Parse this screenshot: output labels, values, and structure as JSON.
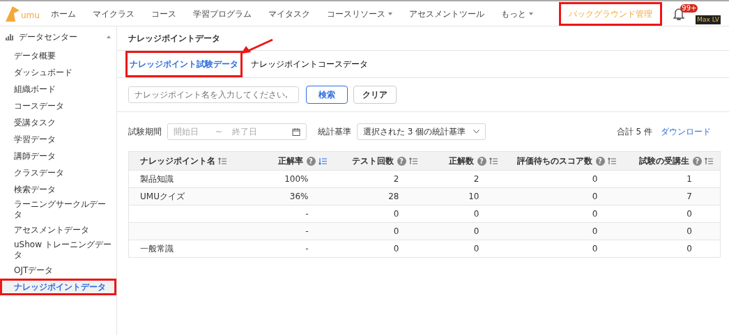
{
  "nav": {
    "logo": "umu",
    "items": [
      {
        "label": "ホーム",
        "dropdown": false
      },
      {
        "label": "マイクラス",
        "dropdown": false
      },
      {
        "label": "コース",
        "dropdown": false
      },
      {
        "label": "学習プログラム",
        "dropdown": false
      },
      {
        "label": "マイタスク",
        "dropdown": false
      },
      {
        "label": "コースリソース",
        "dropdown": true
      },
      {
        "label": "アセスメントツール",
        "dropdown": false
      },
      {
        "label": "もっと",
        "dropdown": true
      }
    ],
    "admin_link": {
      "label": "バックグラウンド管理",
      "highlighted": true
    },
    "notification_badge": "99+",
    "level_badge": "Max LV"
  },
  "sidebar": {
    "section": {
      "label": "データセンター",
      "expanded": true
    },
    "items": [
      {
        "label": "データ概要",
        "selected": false,
        "highlighted": false
      },
      {
        "label": "ダッシュボード",
        "selected": false,
        "highlighted": false
      },
      {
        "label": "組織ボード",
        "selected": false,
        "highlighted": false
      },
      {
        "label": "コースデータ",
        "selected": false,
        "highlighted": false
      },
      {
        "label": "受講タスク",
        "selected": false,
        "highlighted": false
      },
      {
        "label": "学習データ",
        "selected": false,
        "highlighted": false
      },
      {
        "label": "講師データ",
        "selected": false,
        "highlighted": false
      },
      {
        "label": "クラスデータ",
        "selected": false,
        "highlighted": false
      },
      {
        "label": "検索データ",
        "selected": false,
        "highlighted": false
      },
      {
        "label": "ラーニングサークルデータ",
        "selected": false,
        "highlighted": false
      },
      {
        "label": "アセスメントデータ",
        "selected": false,
        "highlighted": false
      },
      {
        "label": "uShow トレーニングデータ",
        "selected": false,
        "highlighted": false
      },
      {
        "label": "OJTデータ",
        "selected": false,
        "highlighted": false
      },
      {
        "label": "ナレッジポイントデータ",
        "selected": true,
        "highlighted": true
      }
    ]
  },
  "page_title": "ナレッジポイントデータ",
  "tabs": [
    {
      "label": "ナレッジポイント試験データ",
      "selected": true,
      "highlighted": true
    },
    {
      "label": "ナレッジポイントコースデータ",
      "selected": false,
      "highlighted": false
    }
  ],
  "search": {
    "placeholder": "ナレッジポイント名を入力してください,",
    "search_button": "検索",
    "clear_button": "クリア"
  },
  "filters": {
    "period_label": "試験期間",
    "start_placeholder": "開始日",
    "separator": "~",
    "end_placeholder": "終了日",
    "criteria_label": "統計基準",
    "criteria_value": "選択された 3 個の統計基準",
    "total": "合計 5 件",
    "download": "ダウンロード"
  },
  "table": {
    "columns": [
      {
        "label": "ナレッジポイント名",
        "sorted": false
      },
      {
        "label": "正解率",
        "help_icon": "?",
        "sorted": true
      },
      {
        "label": "テスト回数",
        "help_icon": "?",
        "sorted": false
      },
      {
        "label": "正解数",
        "help_icon": "?",
        "sorted": false
      },
      {
        "label": "評価待ちのスコア数",
        "help_icon": "?",
        "sorted": false
      },
      {
        "label": "試験の受講生",
        "help_icon": "?",
        "sorted": false
      }
    ],
    "rows": [
      [
        "製品知識",
        "100%",
        "2",
        "2",
        "0",
        "1"
      ],
      [
        "UMUクイズ",
        "36%",
        "28",
        "10",
        "0",
        "7"
      ],
      [
        "",
        "-",
        "0",
        "0",
        "0",
        "0"
      ],
      [
        "",
        "-",
        "0",
        "0",
        "0",
        "0"
      ],
      [
        "一般常識",
        "-",
        "0",
        "0",
        "0",
        "0"
      ]
    ]
  }
}
